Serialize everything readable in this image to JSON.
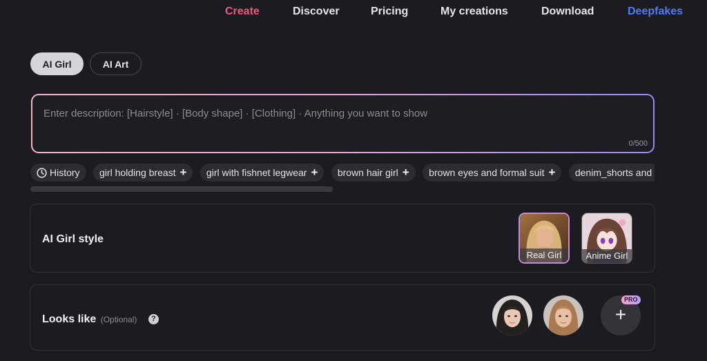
{
  "nav": {
    "items": [
      "Create",
      "Discover",
      "Pricing",
      "My creations",
      "Download",
      "Deepfakes"
    ],
    "colors": {
      "active": "#e85a7e",
      "highlight": "#4f7df2"
    }
  },
  "mode_tabs": {
    "selected": "AI Girl",
    "items": [
      "AI Girl",
      "AI Art"
    ]
  },
  "prompt": {
    "placeholder": "Enter description: [Hairstyle] · [Body shape] · [Clothing] · Anything you want to show",
    "value": "",
    "counter": "0/500"
  },
  "suggestions": {
    "history_label": "History",
    "history_icon": "clock-icon",
    "chips": [
      "girl holding breast",
      "girl with fishnet legwear",
      "brown hair girl",
      "brown eyes and formal suit",
      "denim_shorts and ass"
    ]
  },
  "style_card": {
    "title": "AI Girl style",
    "selected": "Real Girl",
    "options": [
      "Real Girl",
      "Anime Girl"
    ]
  },
  "looks_card": {
    "title": "Looks like",
    "optional": "(Optional)",
    "help_icon": "?",
    "add_icon": "+",
    "pro_badge": "PRO"
  }
}
